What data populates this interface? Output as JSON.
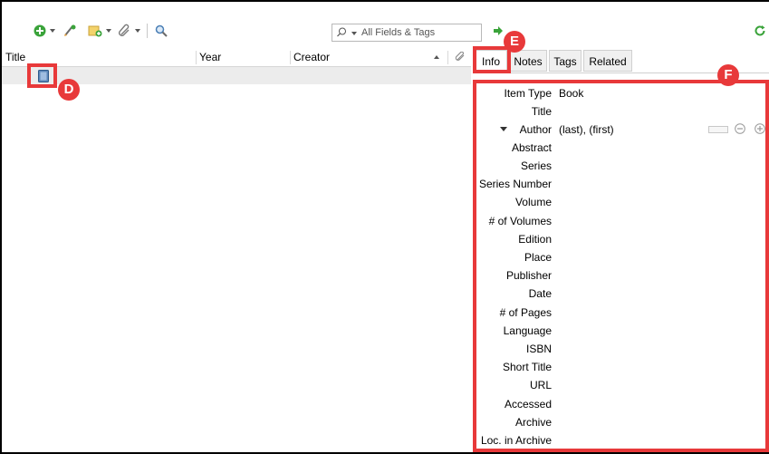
{
  "toolbar": {
    "icons": [
      "new-item-icon",
      "add-by-identifier-icon",
      "new-note-icon",
      "add-attachment-icon",
      "advanced-search-icon",
      "sync-icon",
      "locate-icon"
    ]
  },
  "search": {
    "mode_label": "All Fields & Tags",
    "placeholder": "All Fields & Tags"
  },
  "item_list": {
    "columns": [
      "Title",
      "Year",
      "Creator"
    ]
  },
  "item_pane": {
    "tabs": [
      "Info",
      "Notes",
      "Tags",
      "Related"
    ],
    "active_tab": "Info",
    "fields": [
      {
        "label": "Item Type",
        "value": "Book"
      },
      {
        "label": "Title",
        "value": ""
      },
      {
        "label": "Author",
        "value": "(last), (first)"
      },
      {
        "label": "Abstract",
        "value": ""
      },
      {
        "label": "Series",
        "value": ""
      },
      {
        "label": "Series Number",
        "value": ""
      },
      {
        "label": "Volume",
        "value": ""
      },
      {
        "label": "# of Volumes",
        "value": ""
      },
      {
        "label": "Edition",
        "value": ""
      },
      {
        "label": "Place",
        "value": ""
      },
      {
        "label": "Publisher",
        "value": ""
      },
      {
        "label": "Date",
        "value": ""
      },
      {
        "label": "# of Pages",
        "value": ""
      },
      {
        "label": "Language",
        "value": ""
      },
      {
        "label": "ISBN",
        "value": ""
      },
      {
        "label": "Short Title",
        "value": ""
      },
      {
        "label": "URL",
        "value": ""
      },
      {
        "label": "Accessed",
        "value": ""
      },
      {
        "label": "Archive",
        "value": ""
      },
      {
        "label": "Loc. in Archive",
        "value": ""
      }
    ]
  },
  "annotations": {
    "markers": [
      "D",
      "E",
      "F"
    ],
    "color": "#e8393a"
  },
  "colors": {
    "green_accent": "#3aa33a",
    "highlight": "#e8393a"
  }
}
